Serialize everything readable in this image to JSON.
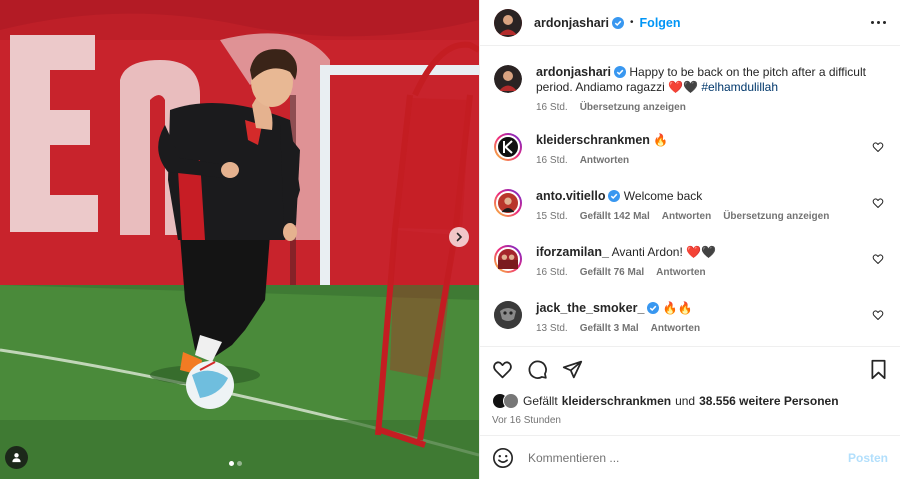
{
  "post": {
    "author": "ardonjashari",
    "follow_label": "Folgen",
    "caption_text": "Happy to be back on the pitch after a difficult period. Andiamo ragazzi ❤️🖤",
    "caption_hashtag": "#elhamdulillah",
    "caption_time": "16 Std.",
    "caption_translate": "Übersetzung anzeigen"
  },
  "comments": [
    {
      "user": "kleiderschrankmen",
      "verified": false,
      "text": "🔥",
      "time": "16 Std.",
      "likes": "",
      "reply": "Antworten",
      "translate": "",
      "avatar_color": "#111111",
      "avatar_letter": "K"
    },
    {
      "user": "anto.vitiello",
      "verified": true,
      "text": "Welcome back",
      "time": "15 Std.",
      "likes": "Gefällt 142 Mal",
      "reply": "Antworten",
      "translate": "Übersetzung anzeigen",
      "avatar_color": "#b9362b",
      "avatar_letter": ""
    },
    {
      "user": "iforzamilan_",
      "verified": false,
      "text": "Avanti Ardon! ❤️🖤",
      "time": "16 Std.",
      "likes": "Gefällt 76 Mal",
      "reply": "Antworten",
      "translate": "",
      "avatar_color": "#a5262b",
      "avatar_letter": ""
    },
    {
      "user": "jack_the_smoker_",
      "verified": true,
      "text": "🔥🔥",
      "time": "13 Std.",
      "likes": "Gefällt 3 Mal",
      "reply": "Antworten",
      "translate": "",
      "avatar_color": "#444444",
      "avatar_letter": ""
    }
  ],
  "likes_summary": {
    "prefix": "Gefällt",
    "user": "kleiderschrankmen",
    "middle": "und",
    "others": "38.556 weitere Personen"
  },
  "post_date": "Vor 16 Stunden",
  "composer": {
    "placeholder": "Kommentieren ...",
    "post_label": "Posten"
  },
  "icons": {
    "like": "heart-icon",
    "comment": "comment-bubble-icon",
    "share": "paper-plane-icon",
    "save": "bookmark-icon",
    "emoji": "smiley-icon",
    "more": "more-dots-icon",
    "next": "chevron-right-icon",
    "tag": "user-tag-icon"
  },
  "colors": {
    "accent": "#0095f6",
    "verified": "#3897f0",
    "muted": "#737373",
    "post_disabled": "#b2dffc"
  },
  "carousel": {
    "total": 2,
    "active": 1
  }
}
